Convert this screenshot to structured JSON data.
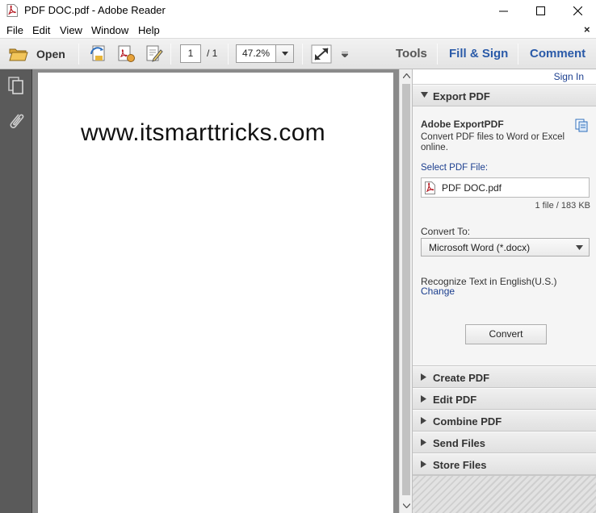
{
  "window": {
    "title": "PDF DOC.pdf - Adobe Reader"
  },
  "menubar": {
    "items": [
      "File",
      "Edit",
      "View",
      "Window",
      "Help"
    ],
    "close_glyph": "×"
  },
  "toolbar": {
    "open_label": "Open",
    "page_current": "1",
    "page_total": "/ 1",
    "zoom": "47.2%",
    "tools_label": "Tools",
    "fill_sign_label": "Fill & Sign",
    "comment_label": "Comment"
  },
  "document": {
    "text": "www.itsmarttricks.com"
  },
  "right_panel": {
    "sign_in": "Sign In",
    "export_section": "Export PDF",
    "export_title": "Adobe ExportPDF",
    "export_desc": "Convert PDF files to Word or Excel online.",
    "select_label": "Select PDF File:",
    "file_name": "PDF DOC.pdf",
    "file_info": "1 file / 183 KB",
    "convert_to_label": "Convert To:",
    "format_value": "Microsoft Word (*.docx)",
    "recognize_text": "Recognize Text in English(U.S.)",
    "change_link": "Change",
    "convert_button": "Convert",
    "sections": [
      "Create PDF",
      "Edit PDF",
      "Combine PDF",
      "Send Files",
      "Store Files"
    ]
  },
  "colors": {
    "accent_blue": "#1c3f8f",
    "pdf_red": "#b3121b",
    "nav_gray": "#5a5a5a"
  }
}
